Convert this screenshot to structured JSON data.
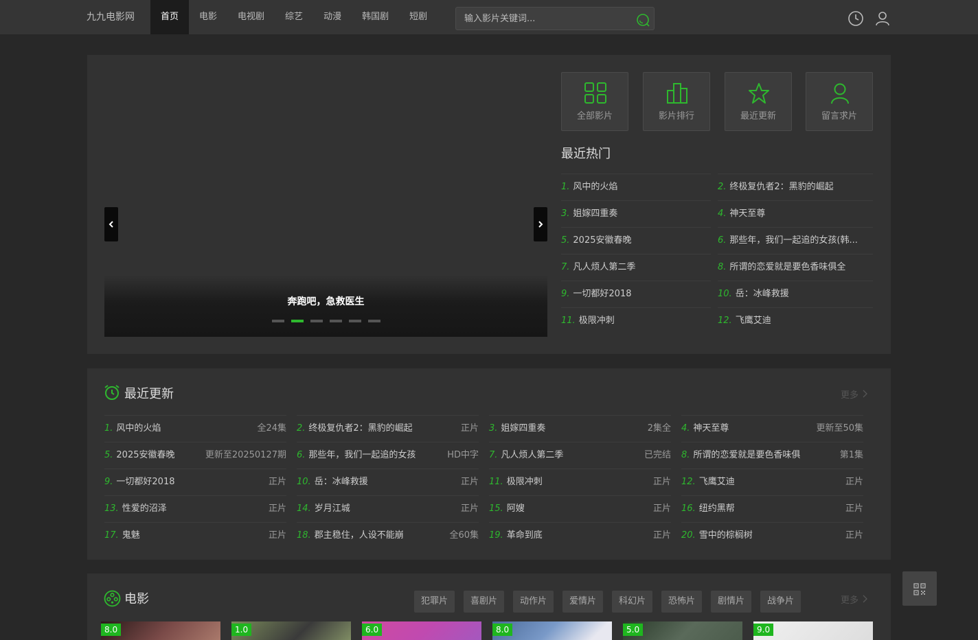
{
  "header": {
    "logo": "九九电影网",
    "nav": [
      "首页",
      "电影",
      "电视剧",
      "综艺",
      "动漫",
      "韩国剧",
      "短剧"
    ],
    "active_nav": 0,
    "search_placeholder": "输入影片关键词...",
    "icons": [
      "search-icon",
      "history-clock-icon",
      "user-icon"
    ]
  },
  "slider": {
    "caption": "奔跑吧，急救医生",
    "slide_count": 6,
    "active_slide": 1
  },
  "quick_links": [
    {
      "label": "全部影片",
      "icon": "grid-icon"
    },
    {
      "label": "影片排行",
      "icon": "bar-chart-icon"
    },
    {
      "label": "最近更新",
      "icon": "star-icon"
    },
    {
      "label": "留言求片",
      "icon": "user-icon"
    }
  ],
  "hot": {
    "title": "最近热门",
    "items": [
      {
        "num": "1.",
        "name": "风中的火焰"
      },
      {
        "num": "2.",
        "name": "终极复仇者2：黑豹的崛起"
      },
      {
        "num": "3.",
        "name": "姐嫁四重奏"
      },
      {
        "num": "4.",
        "name": "神天至尊"
      },
      {
        "num": "5.",
        "name": "2025安徽春晚"
      },
      {
        "num": "6.",
        "name": "那些年，我们一起追的女孩(韩..."
      },
      {
        "num": "7.",
        "name": "凡人烦人第二季"
      },
      {
        "num": "8.",
        "name": "所谓的恋爱就是要色香味俱全"
      },
      {
        "num": "9.",
        "name": "一切都好2018"
      },
      {
        "num": "10.",
        "name": "岳：冰峰救援"
      },
      {
        "num": "11.",
        "name": "极限冲刺"
      },
      {
        "num": "12.",
        "name": "飞鹰艾迪"
      }
    ]
  },
  "updates": {
    "title": "最近更新",
    "more": "更多",
    "items": [
      {
        "num": "1.",
        "name": "风中的火焰",
        "status": "全24集"
      },
      {
        "num": "2.",
        "name": "终极复仇者2：黑豹的崛起",
        "status": "正片"
      },
      {
        "num": "3.",
        "name": "姐嫁四重奏",
        "status": "2集全"
      },
      {
        "num": "4.",
        "name": "神天至尊",
        "status": "更新至50集"
      },
      {
        "num": "5.",
        "name": "2025安徽春晚",
        "status": "更新至20250127期"
      },
      {
        "num": "6.",
        "name": "那些年，我们一起追的女孩",
        "status": "HD中字"
      },
      {
        "num": "7.",
        "name": "凡人烦人第二季",
        "status": "已完结"
      },
      {
        "num": "8.",
        "name": "所谓的恋爱就是要色香味俱",
        "status": "第1集"
      },
      {
        "num": "9.",
        "name": "一切都好2018",
        "status": "正片"
      },
      {
        "num": "10.",
        "name": "岳：冰峰救援",
        "status": "正片"
      },
      {
        "num": "11.",
        "name": "极限冲刺",
        "status": "正片"
      },
      {
        "num": "12.",
        "name": "飞鹰艾迪",
        "status": "正片"
      },
      {
        "num": "13.",
        "name": "性爱的沼泽",
        "status": "正片"
      },
      {
        "num": "14.",
        "name": "岁月江城",
        "status": "正片"
      },
      {
        "num": "15.",
        "name": "阿嫂",
        "status": "正片"
      },
      {
        "num": "16.",
        "name": "纽约黑帮",
        "status": "正片"
      },
      {
        "num": "17.",
        "name": "鬼魅",
        "status": "正片"
      },
      {
        "num": "18.",
        "name": "郡主稳住，人设不能崩",
        "status": "全60集"
      },
      {
        "num": "19.",
        "name": "革命到底",
        "status": "正片"
      },
      {
        "num": "20.",
        "name": "雪中的棕榈树",
        "status": "正片"
      }
    ]
  },
  "movies": {
    "title": "电影",
    "more": "更多",
    "tags": [
      "犯罪片",
      "喜剧片",
      "动作片",
      "爱情片",
      "科幻片",
      "恐怖片",
      "剧情片",
      "战争片"
    ],
    "posters": [
      {
        "score": "8.0",
        "color": "#6a3a3a"
      },
      {
        "score": "1.0",
        "color": "#5a6a4a"
      },
      {
        "score": "6.0",
        "color": "#b04aa0"
      },
      {
        "score": "8.0",
        "color": "#6a8ab0"
      },
      {
        "score": "5.0",
        "color": "#4a5a4a"
      },
      {
        "score": "9.0",
        "color": "#e8e8e8"
      }
    ]
  },
  "colors": {
    "accent": "#2eb82e",
    "panel": "#323232",
    "background": "#282828"
  }
}
